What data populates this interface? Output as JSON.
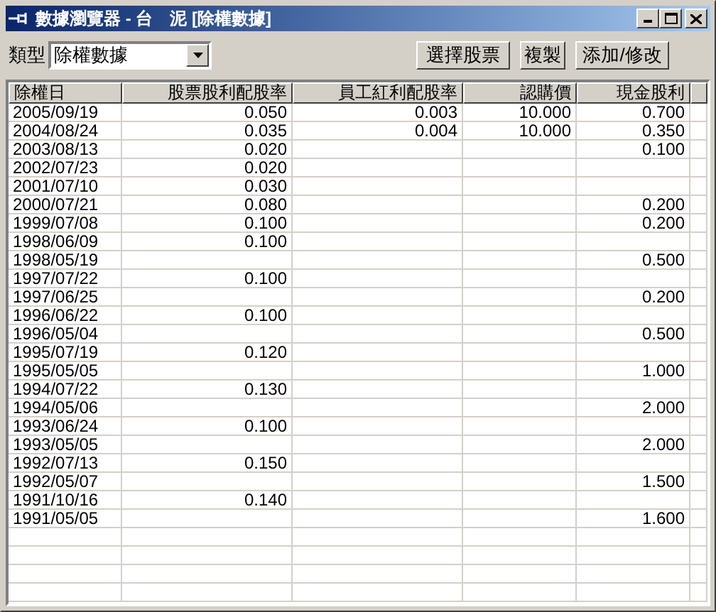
{
  "window": {
    "title": "數據瀏覽器 - 台　泥 [除權數據]"
  },
  "toolbar": {
    "type_label": "類型",
    "type_value": "除權數據",
    "buttons": [
      "選擇股票",
      "複製",
      "添加/修改"
    ]
  },
  "table": {
    "columns": [
      "除權日",
      "股票股利配股率",
      "員工紅利配股率",
      "認購價",
      "現金股利"
    ],
    "rows": [
      [
        "2005/09/19",
        "0.050",
        "0.003",
        "10.000",
        "0.700"
      ],
      [
        "2004/08/24",
        "0.035",
        "0.004",
        "10.000",
        "0.350"
      ],
      [
        "2003/08/13",
        "0.020",
        "",
        "",
        "0.100"
      ],
      [
        "2002/07/23",
        "0.020",
        "",
        "",
        ""
      ],
      [
        "2001/07/10",
        "0.030",
        "",
        "",
        ""
      ],
      [
        "2000/07/21",
        "0.080",
        "",
        "",
        "0.200"
      ],
      [
        "1999/07/08",
        "0.100",
        "",
        "",
        "0.200"
      ],
      [
        "1998/06/09",
        "0.100",
        "",
        "",
        ""
      ],
      [
        "1998/05/19",
        "",
        "",
        "",
        "0.500"
      ],
      [
        "1997/07/22",
        "0.100",
        "",
        "",
        ""
      ],
      [
        "1997/06/25",
        "",
        "",
        "",
        "0.200"
      ],
      [
        "1996/06/22",
        "0.100",
        "",
        "",
        ""
      ],
      [
        "1996/05/04",
        "",
        "",
        "",
        "0.500"
      ],
      [
        "1995/07/19",
        "0.120",
        "",
        "",
        ""
      ],
      [
        "1995/05/05",
        "",
        "",
        "",
        "1.000"
      ],
      [
        "1994/07/22",
        "0.130",
        "",
        "",
        ""
      ],
      [
        "1994/05/06",
        "",
        "",
        "",
        "2.000"
      ],
      [
        "1993/06/24",
        "0.100",
        "",
        "",
        ""
      ],
      [
        "1993/05/05",
        "",
        "",
        "",
        "2.000"
      ],
      [
        "1992/07/13",
        "0.150",
        "",
        "",
        ""
      ],
      [
        "1992/05/07",
        "",
        "",
        "",
        "1.500"
      ],
      [
        "1991/10/16",
        "0.140",
        "",
        "",
        ""
      ],
      [
        "1991/05/05",
        "",
        "",
        "",
        "1.600"
      ]
    ]
  }
}
